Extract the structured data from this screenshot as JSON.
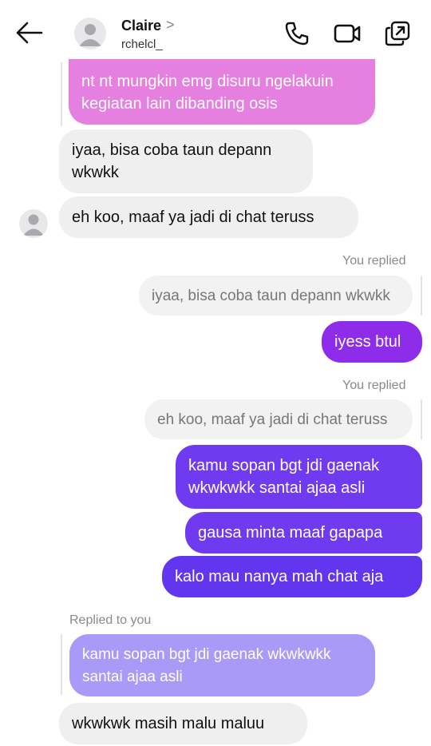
{
  "header": {
    "contact_name": "Claire",
    "chevron": ">",
    "username": "rchelcl_",
    "icons": [
      "back-arrow-icon",
      "phone-icon",
      "video-icon",
      "share-icon"
    ]
  },
  "messages": {
    "m1": "nt nt mungkin emg disuru ngelakuin\nkegiatan lain dibanding osis",
    "m2": "iyaa, bisa coba taun depann\nwkwkk",
    "m3": "eh koo, maaf ya jadi di chat teruss",
    "reply1_label": "You replied",
    "reply1_quote": "iyaa, bisa coba taun depann wkwkk",
    "m4": "iyess btul",
    "reply2_label": "You replied",
    "reply2_quote": "eh koo, maaf ya jadi di chat teruss",
    "m5": "kamu sopan bgt jdi gaenak\nwkwkwkk santai ajaa asli",
    "m6": "gausa minta maaf gapapa",
    "m7": "kalo mau nanya mah chat aja",
    "reply3_label": "Replied to you",
    "reply3_quote": "kamu sopan bgt jdi gaenak wkwkwkk\nsantai ajaa asli",
    "m8": "wkwkwk masih malu maluu"
  },
  "colors": {
    "pink": "#e57fe0",
    "gray": "#efefef",
    "purple_dark": "#8e2de9",
    "purple_blue": "#6f3af0",
    "lavender": "#a89af6"
  }
}
